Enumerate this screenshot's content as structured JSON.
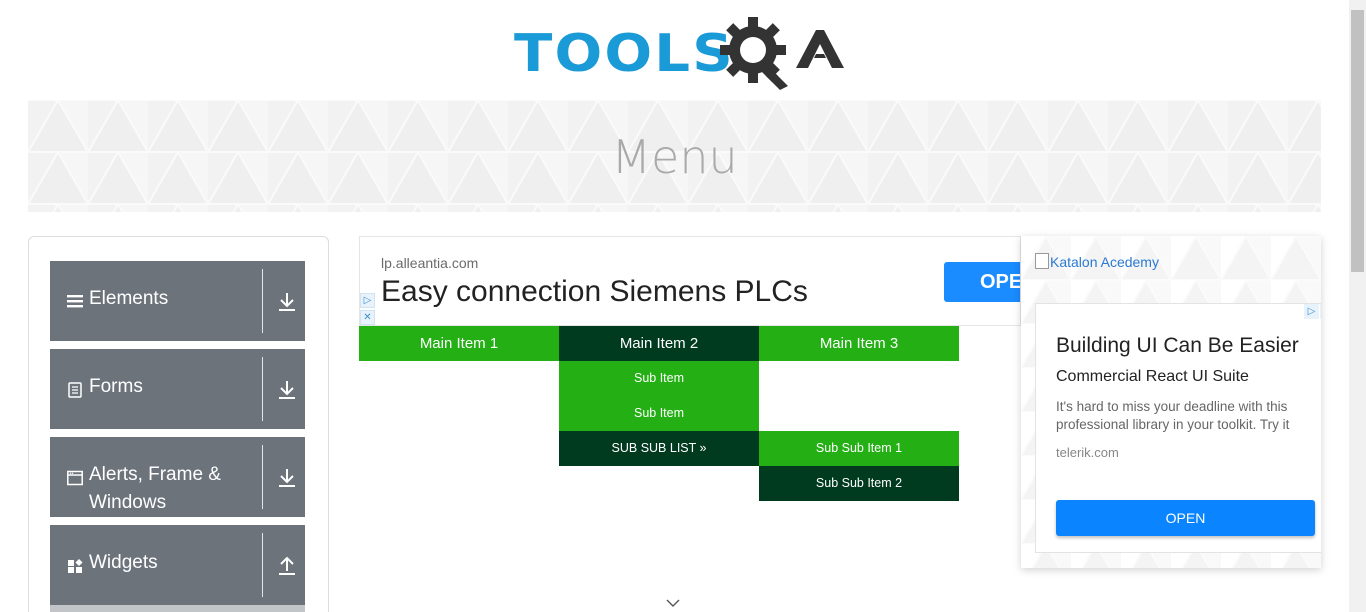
{
  "header": {
    "logo_text": "TOOLS",
    "logo_suffix": "QA"
  },
  "banner": {
    "title": "Menu"
  },
  "sidebar": {
    "groups": [
      {
        "label": "Elements",
        "icon": "hamburger-icon",
        "state": "collapsed"
      },
      {
        "label": "Forms",
        "icon": "document-icon",
        "state": "collapsed"
      },
      {
        "label": "Alerts, Frame & Windows",
        "icon": "window-icon",
        "state": "collapsed"
      },
      {
        "label": "Widgets",
        "icon": "widgets-icon",
        "state": "expanded"
      }
    ]
  },
  "ad_top": {
    "domain": "lp.alleantia.com",
    "headline": "Easy connection Siemens PLCs",
    "open_label": "OPEN"
  },
  "menu": {
    "main_items": [
      "Main Item 1",
      "Main Item 2",
      "Main Item 3"
    ],
    "sub_items": [
      "Sub Item",
      "Sub Item",
      "SUB SUB LIST »"
    ],
    "sub_sub_items": [
      "Sub Sub Item 1",
      "Sub Sub Item 2"
    ]
  },
  "side_ad": {
    "broken_image_alt": "Katalon Acedemy",
    "title": "Building UI Can Be Easier",
    "subtitle": "Commercial React UI Suite",
    "body": "It's hard to miss your deadline with this professional library in your toolkit. Try it",
    "domain": "telerik.com",
    "open_label": "OPEN"
  },
  "colors": {
    "brand_blue": "#1a9ad6",
    "menu_green": "#24af15",
    "menu_dark": "#003a1f",
    "sidebar_gray": "#6c737b"
  }
}
